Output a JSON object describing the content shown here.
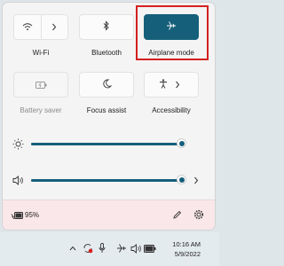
{
  "tiles": {
    "wifi": {
      "label": "Wi-Fi"
    },
    "bluetooth": {
      "label": "Bluetooth"
    },
    "airplane": {
      "label": "Airplane mode"
    },
    "battery_saver": {
      "label": "Battery saver"
    },
    "focus_assist": {
      "label": "Focus assist"
    },
    "accessibility": {
      "label": "Accessibility"
    }
  },
  "brightness": {
    "level": 1.0
  },
  "volume": {
    "level": 1.0
  },
  "battery": {
    "percent_label": "95%"
  },
  "taskbar": {
    "time": "10:16 AM",
    "date": "5/9/2022"
  },
  "colors": {
    "accent": "#155f7a",
    "highlight": "#d4201f"
  }
}
